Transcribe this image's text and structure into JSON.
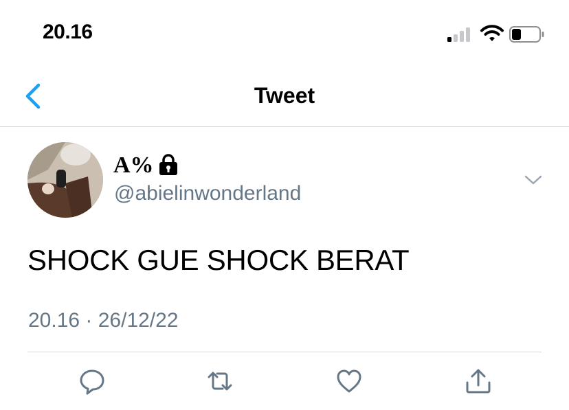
{
  "status_bar": {
    "time": "20.16",
    "signal_bars_active": 1,
    "signal_bars_total": 4
  },
  "nav": {
    "back_icon": "chevron-left-icon",
    "title": "Tweet"
  },
  "tweet": {
    "display_name": "A%",
    "protected_icon": "lock-icon",
    "handle": "@abielinwonderland",
    "text": "SHOCK GUE SHOCK BERAT",
    "timestamp": "20.16 · 26/12/22",
    "menu_icon": "chevron-down-icon"
  },
  "actions": [
    "reply-icon",
    "retweet-icon",
    "like-icon",
    "share-icon"
  ],
  "colors": {
    "accent": "#1da1f2",
    "secondary_text": "#657786",
    "icon_gray": "#657786",
    "divider": "#d3d6da"
  }
}
